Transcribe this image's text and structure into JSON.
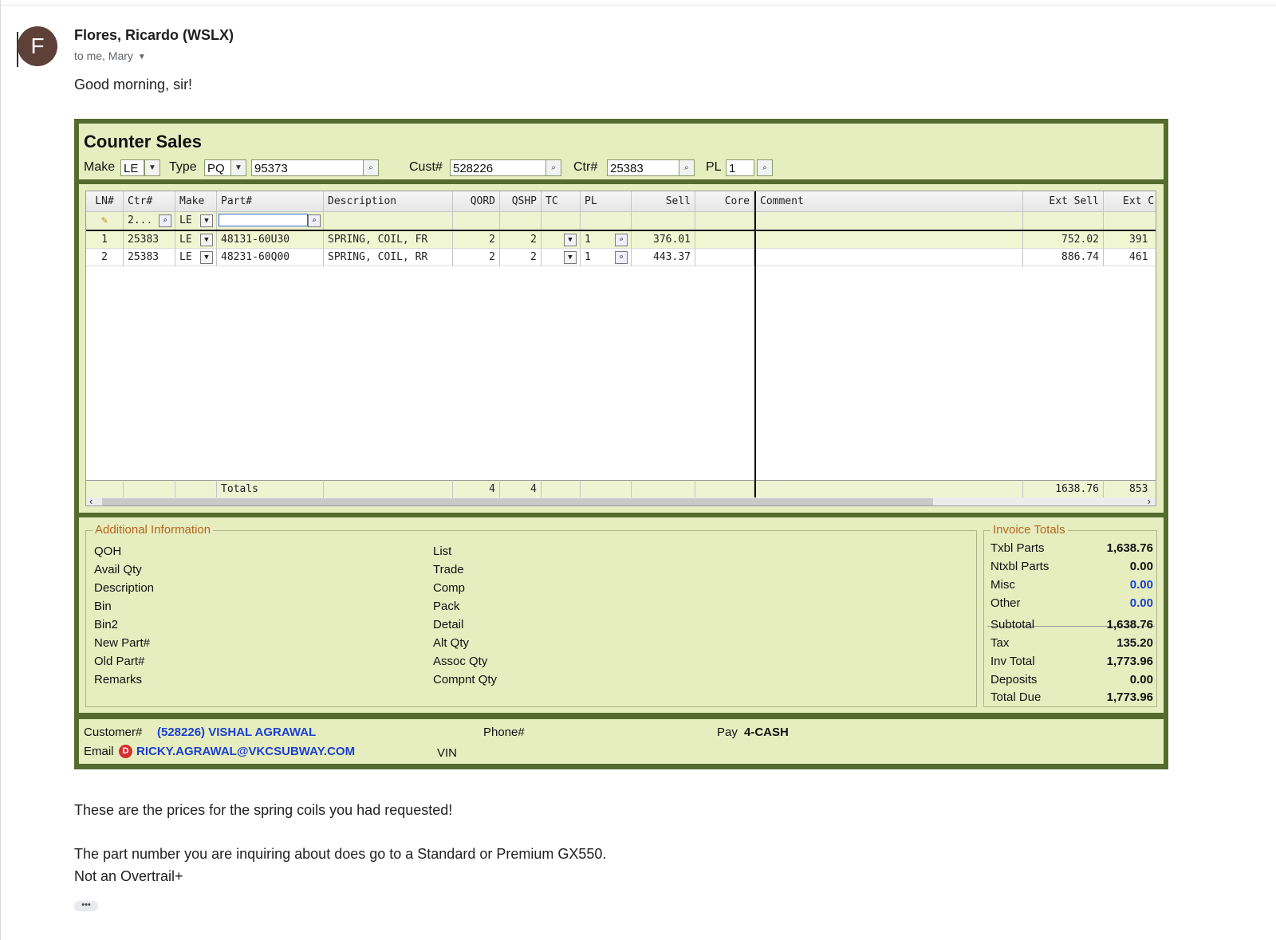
{
  "email": {
    "avatar_letter": "F",
    "sender": "Flores, Ricardo (WSLX)",
    "recipients": "to me, Mary",
    "greeting": "Good morning, sir!",
    "body1": "These are the prices for the spring coils you had requested!",
    "body2": "The part number you are inquiring about does go to a Standard or Premium GX550.",
    "body3": "Not an Overtrail+",
    "more": "•••"
  },
  "counter": {
    "title": "Counter Sales",
    "make_label": "Make",
    "make_value": "LE",
    "type_label": "Type",
    "type_value": "PQ",
    "type_number": "95373",
    "cust_label": "Cust#",
    "cust_value": "528226",
    "ctr_label": "Ctr#",
    "ctr_value": "25383",
    "pl_label": "PL",
    "pl_value": "1"
  },
  "grid": {
    "headers": [
      "LN#",
      "Ctr#",
      "Make",
      "Part#",
      "Description",
      "QORD",
      "QSHP",
      "TC",
      "PL",
      "Sell",
      "Core",
      "Comment",
      "Ext Sell",
      "Ext C"
    ],
    "filter": {
      "ctr": "2...",
      "make": "LE"
    },
    "rows": [
      {
        "ln": "1",
        "ctr": "25383",
        "make": "LE",
        "part": "48131-60U30",
        "desc": "SPRING, COIL, FR",
        "qord": "2",
        "qshp": "2",
        "pl": "1",
        "sell": "376.01",
        "ext_sell": "752.02",
        "ext_c": "391"
      },
      {
        "ln": "2",
        "ctr": "25383",
        "make": "LE",
        "part": "48231-60Q00",
        "desc": "SPRING, COIL, RR",
        "qord": "2",
        "qshp": "2",
        "pl": "1",
        "sell": "443.37",
        "ext_sell": "886.74",
        "ext_c": "461"
      }
    ],
    "totals": {
      "label": "Totals",
      "qord": "4",
      "qshp": "4",
      "ext_sell": "1638.76",
      "ext_c": "853"
    }
  },
  "additional": {
    "legend": "Additional Information",
    "col1": [
      "QOH",
      "Avail Qty",
      "Description",
      "Bin",
      "Bin2",
      "New Part#",
      "Old Part#",
      "Remarks"
    ],
    "col2": [
      "List",
      "Trade",
      "Comp",
      "Pack",
      "Detail",
      "Alt Qty",
      "Assoc Qty",
      "Compnt Qty"
    ]
  },
  "invoice": {
    "legend": "Invoice Totals",
    "rows": [
      {
        "label": "Txbl Parts",
        "value": "1,638.76"
      },
      {
        "label": "Ntxbl Parts",
        "value": "0.00"
      },
      {
        "label": "Misc",
        "value": "0.00"
      },
      {
        "label": "Other",
        "value": "0.00"
      },
      {
        "label": "Subtotal",
        "value": "1,638.76"
      },
      {
        "label": "Tax",
        "value": "135.20"
      },
      {
        "label": "Inv Total",
        "value": "1,773.96"
      },
      {
        "label": "Deposits",
        "value": "0.00"
      },
      {
        "label": "Total Due",
        "value": "1,773.96"
      }
    ]
  },
  "footer": {
    "customer_label": "Customer#",
    "customer_value": "(528226) VISHAL AGRAWAL",
    "phone_label": "Phone#",
    "pay_label": "Pay",
    "pay_value": "4-CASH",
    "email_label": "Email",
    "email_badge": "D",
    "email_value": "RICKY.AGRAWAL@VKCSUBWAY.COM",
    "vin_label": "VIN"
  }
}
